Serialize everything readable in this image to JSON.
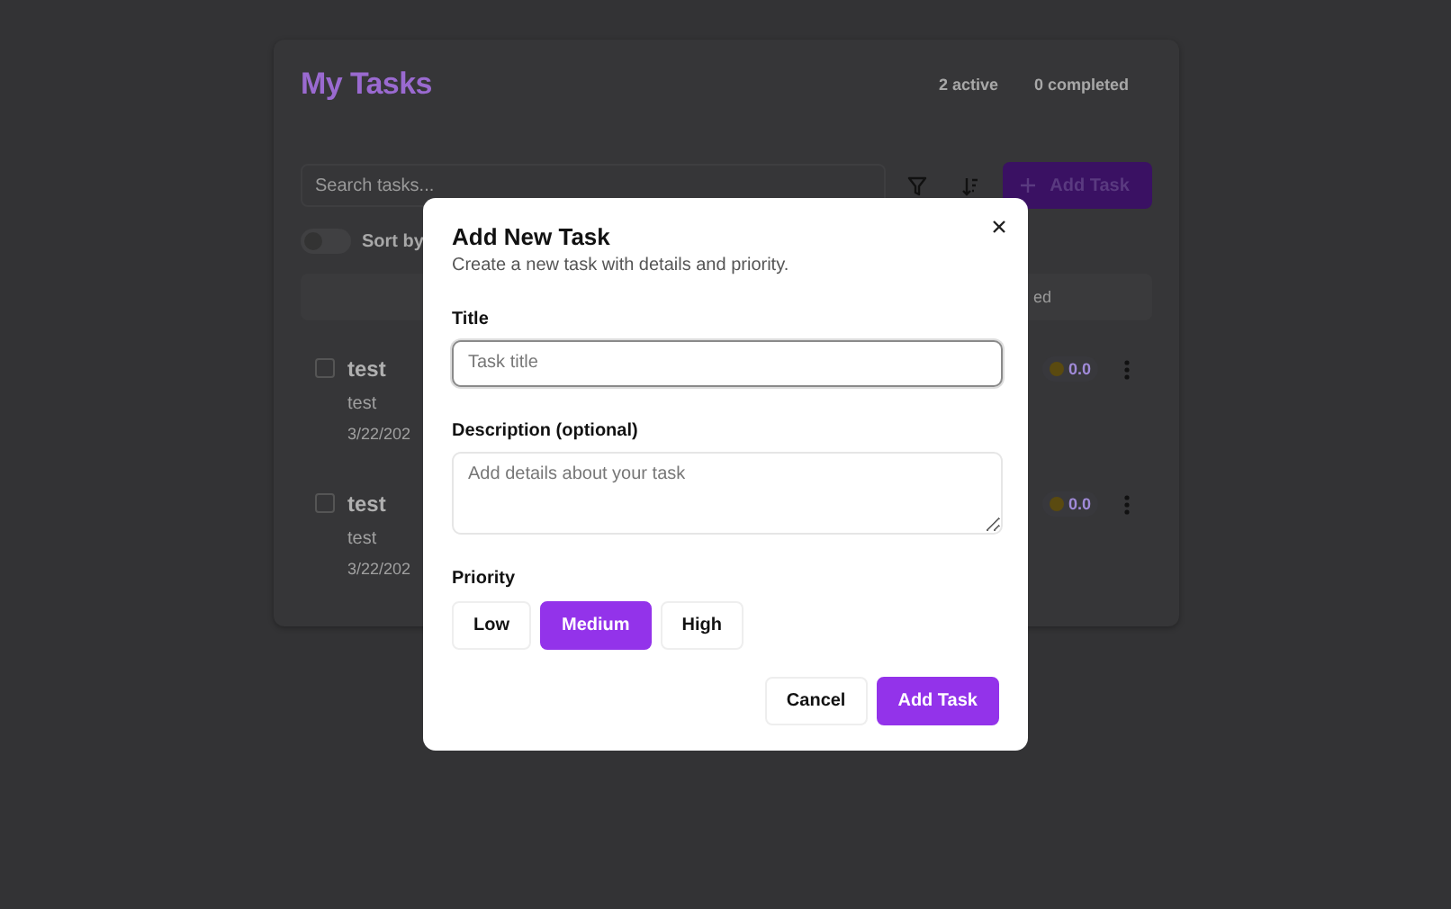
{
  "app": {
    "title": "My Tasks",
    "stats": [
      "2 active",
      "0 completed"
    ],
    "search": {
      "placeholder": "Search tasks..."
    },
    "add_button": {
      "label": "Add Task"
    },
    "sort_toggle": {
      "label": "Sort by",
      "on": false
    },
    "list_header": {
      "column_partial": "ed"
    },
    "tasks": [
      {
        "title": "test",
        "description": "test",
        "date": "3/22/202",
        "score": "0.0",
        "checked": false
      },
      {
        "title": "test",
        "description": "test",
        "date": "3/22/202",
        "score": "0.0",
        "checked": false
      }
    ]
  },
  "dialog": {
    "title": "Add New Task",
    "subtitle": "Create a new task with details and priority.",
    "fields": [
      {
        "kind": "input",
        "label": "Title",
        "placeholder": "Task title",
        "focused": true
      },
      {
        "kind": "textarea",
        "label": "Description (optional)",
        "placeholder": "Add details about your task",
        "focused": false
      }
    ],
    "priority": {
      "label": "Priority",
      "options": [
        {
          "label": "Low",
          "selected": false
        },
        {
          "label": "Medium",
          "selected": true
        },
        {
          "label": "High",
          "selected": false
        }
      ]
    },
    "buttons": [
      {
        "kind": "secondary",
        "label": "Cancel"
      },
      {
        "kind": "primary",
        "label": "Add Task"
      }
    ]
  }
}
